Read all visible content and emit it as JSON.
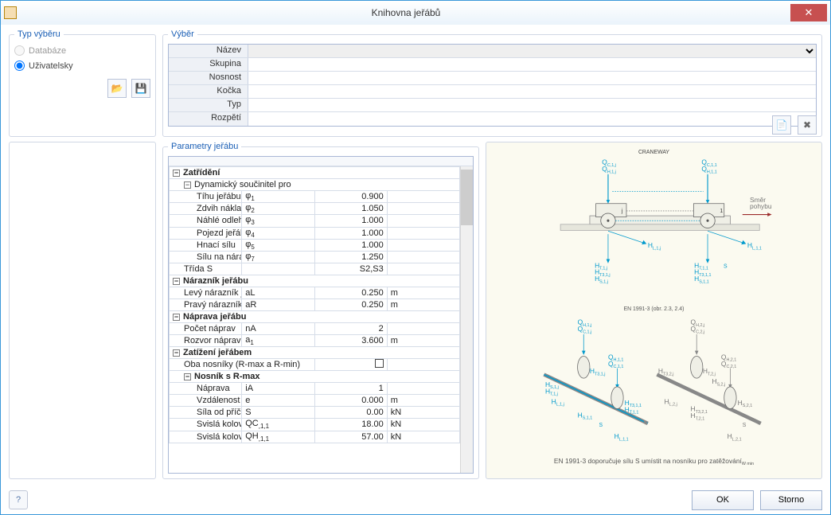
{
  "window": {
    "title": "Knihovna jeřábů"
  },
  "typ_vyberu": {
    "legend": "Typ výběru",
    "opt_db": "Databáze",
    "opt_user": "Uživatelsky"
  },
  "vyber": {
    "legend": "Výběr",
    "rows": [
      "Název",
      "Skupina",
      "Nosnost",
      "Kočka",
      "Typ",
      "Rozpětí"
    ]
  },
  "params": {
    "legend": "Parametry jeřábu",
    "rows": [
      {
        "type": "group",
        "label": "Zatřídění",
        "indent": 0,
        "bold": true
      },
      {
        "type": "group",
        "label": "Dynamický součinitel pro",
        "indent": 1
      },
      {
        "type": "row",
        "label": "Tíhu jeřábu",
        "indent": 2,
        "sym": "φ1",
        "val": "0.900",
        "unit": ""
      },
      {
        "type": "row",
        "label": "Zdvih nákladu",
        "indent": 2,
        "sym": "φ2",
        "val": "1.050",
        "unit": ""
      },
      {
        "type": "row",
        "label": "Náhlé odlehčení",
        "indent": 2,
        "sym": "φ3",
        "val": "1.000",
        "unit": ""
      },
      {
        "type": "row",
        "label": "Pojezd jeřábu",
        "indent": 2,
        "sym": "φ4",
        "val": "1.000",
        "unit": ""
      },
      {
        "type": "row",
        "label": "Hnací sílu",
        "indent": 2,
        "sym": "φ5",
        "val": "1.000",
        "unit": ""
      },
      {
        "type": "row",
        "label": "Sílu na nárazníky",
        "indent": 2,
        "sym": "φ7",
        "val": "1.250",
        "unit": ""
      },
      {
        "type": "row",
        "label": "Třída S",
        "indent": 1,
        "sym": "",
        "val": "S2,S3",
        "unit": ""
      },
      {
        "type": "group",
        "label": "Nárazník jeřábu",
        "indent": 0,
        "bold": true
      },
      {
        "type": "row",
        "label": "Levý nárazník jeřábu",
        "indent": 1,
        "sym": "aL",
        "val": "0.250",
        "unit": "m"
      },
      {
        "type": "row",
        "label": "Pravý nárazník jeřábu",
        "indent": 1,
        "sym": "aR",
        "val": "0.250",
        "unit": "m"
      },
      {
        "type": "group",
        "label": "Náprava jeřábu",
        "indent": 0,
        "bold": true
      },
      {
        "type": "row",
        "label": "Počet náprav",
        "indent": 1,
        "sym": "nA",
        "val": "2",
        "unit": ""
      },
      {
        "type": "row",
        "label": "Rozvor náprav",
        "indent": 1,
        "sym": "a1",
        "val": "3.600",
        "unit": "m"
      },
      {
        "type": "group",
        "label": "Zatížení jeřábem",
        "indent": 0,
        "bold": true
      },
      {
        "type": "chk",
        "label": "Oba nosníky (R-max a R-min)",
        "indent": 1
      },
      {
        "type": "group",
        "label": "Nosník s R-max",
        "indent": 1,
        "bold": true
      },
      {
        "type": "row",
        "label": "Náprava",
        "indent": 2,
        "sym": "iA",
        "val": "1",
        "unit": ""
      },
      {
        "type": "row",
        "label": "Vzdálenost síly od příčení jeřábu",
        "indent": 2,
        "sym": "e",
        "val": "0.000",
        "unit": "m"
      },
      {
        "type": "row",
        "label": "Síla od příčení jeřábu",
        "indent": 2,
        "sym": "S",
        "val": "0.00",
        "unit": "kN"
      },
      {
        "type": "row",
        "label": "Svislá kolová zatížení",
        "indent": 2,
        "sym": "QC,1,1",
        "val": "18.00",
        "unit": "kN"
      },
      {
        "type": "row",
        "label": "Svislá kolová zatížení",
        "indent": 2,
        "sym": "QH,1,1",
        "val": "57.00",
        "unit": "kN"
      }
    ]
  },
  "diagram": {
    "title_top": "CRANEWAY",
    "mid_caption": "EN 1991-3 (obr. 2.3, 2.4)",
    "bottom_caption": "EN 1991-3 doporučuje sílu S umístit na nosníku pro zatěžování",
    "bottom_sub": "W min",
    "dir_label": "Směr\npohybu",
    "labels": {
      "QCj": "Q",
      "QCjs": "C,1,j",
      "QHj": "Q",
      "QHjs": "H,1,j",
      "QC1": "Q",
      "QC1s": "C,1,1",
      "QH1": "Q",
      "QH1s": "H,1,1",
      "j": "j",
      "one": "1",
      "HLj": "H",
      "HLjs": "L,1,j",
      "HL1": "H",
      "HL1s": "L,1,1",
      "HTj": "H",
      "HTjs": "T,1,j",
      "HT3j": "H",
      "HT3js": "T3,1,j",
      "HSj": "H",
      "HSjs": "S,1,j",
      "HT1": "H",
      "HT1s": "T,1,1",
      "HT31": "H",
      "HT31s": "T3,1,1",
      "HS1": "H",
      "HS1s": "S,1,1",
      "S": "S",
      "d2_QHj": "Q",
      "d2_QHjs": "H,1,j",
      "d2_QCj": "Q",
      "d2_QCjs": "C,1,j",
      "d2_QH2": "Q",
      "d2_QH2s": "H,2,j",
      "d2_QC2": "Q",
      "d2_QC2s": "C,2,j",
      "d2_QH11": "Q",
      "d2_QH11s": "H,1,1",
      "d2_QC11": "Q",
      "d2_QC11s": "C,1,1",
      "d2_QH21": "Q",
      "d2_QH21s": "H,2,1",
      "d2_QC21": "Q",
      "d2_QC21s": "C,2,1",
      "d2_HT3j": "H",
      "d2_HT3js": "T3,1,j",
      "d2_HSj": "H",
      "d2_HSjs": "S,1,j",
      "d2_HTj": "H",
      "d2_HTjs": "T,1,j",
      "d2_HLj": "H",
      "d2_HLjs": "L,1,j",
      "d2_HT31": "H",
      "d2_HT31s": "T3,1,1",
      "d2_HS1": "H",
      "d2_HS1s": "S,1,1",
      "d2_HT1": "H",
      "d2_HT1s": "T,1,1",
      "d2_HL1": "H",
      "d2_HL1s": "L,1,1",
      "d2_S": "S",
      "d2_HT32j": "H",
      "d2_HT32js": "T3,2,j",
      "d2_HT2j": "H",
      "d2_HT2js": "T,2,j",
      "d2_HS2j": "H",
      "d2_HS2js": "S,2,j",
      "d2_HL2j": "H",
      "d2_HL2js": "L,2,j",
      "d2_HT321": "H",
      "d2_HT321s": "T3,2,1",
      "d2_HT21": "H",
      "d2_HT21s": "T,2,1",
      "d2_HS21": "H",
      "d2_HS21s": "S,2,1",
      "d2_HL21": "H",
      "d2_HL21s": "L,2,1",
      "d2_S2": "S"
    }
  },
  "footer": {
    "ok": "OK",
    "cancel": "Storno"
  }
}
